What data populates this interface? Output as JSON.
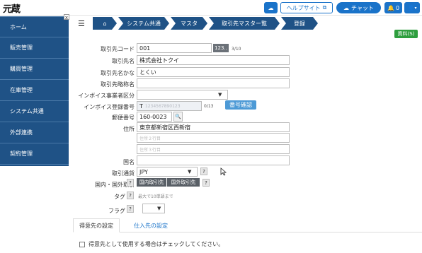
{
  "app": {
    "logo": "元蔵"
  },
  "topbar": {
    "help_label": "ヘルプサイト",
    "chat_label": "チャット",
    "bell_count": "0"
  },
  "sidebar": {
    "items": [
      {
        "label": "ホーム"
      },
      {
        "label": "販売管理"
      },
      {
        "label": "購買管理"
      },
      {
        "label": "在庫管理"
      },
      {
        "label": "システム共通"
      },
      {
        "label": "外部連携"
      },
      {
        "label": "契約管理"
      }
    ],
    "close_label": "x"
  },
  "breadcrumb": {
    "items": [
      {
        "label": "システム共通"
      },
      {
        "label": "マスタ"
      },
      {
        "label": "取引先マスター覧"
      },
      {
        "label": "登録"
      }
    ]
  },
  "help_badge": "資料(S)",
  "form": {
    "code": {
      "label": "取引先コード",
      "value": "001",
      "btn": "123..",
      "counter": "3/10"
    },
    "name": {
      "label": "取引先名",
      "value": "株式会社トクイ"
    },
    "kana": {
      "label": "取引先名かな",
      "value": "とくい"
    },
    "short": {
      "label": "取引先略称名",
      "value": ""
    },
    "invoice_type": {
      "label": "インボイス事業者区分",
      "value": ""
    },
    "invoice_no": {
      "label": "インボイス登録番号",
      "prefix": "T",
      "placeholder": "1234567890123",
      "counter": "0/13",
      "btn": "番号確認"
    },
    "zip": {
      "label": "郵便番号",
      "value": "160-0023"
    },
    "address": {
      "label": "住所",
      "line1": "東京都新宿区西新宿",
      "line2_placeholder": "住所２行目",
      "line3_placeholder": "住所３行目"
    },
    "country": {
      "label": "国名",
      "value": ""
    },
    "currency": {
      "label": "取引通貨",
      "value": "JPY",
      "help": "?"
    },
    "domestic": {
      "label": "国内・国外取引",
      "help": "?",
      "opt1": "国内取引先",
      "opt2": "国外取引先",
      "help2": "?"
    },
    "tag": {
      "label": "タグ",
      "help": "?",
      "note": "最大で10単語まで"
    },
    "flag": {
      "label": "フラグ",
      "help": "?"
    }
  },
  "tabs": [
    {
      "label": "得意先の設定"
    },
    {
      "label": "仕入先の設定"
    }
  ],
  "checkbox": {
    "label": "得意先として使用する場合はチェックしてください。"
  }
}
